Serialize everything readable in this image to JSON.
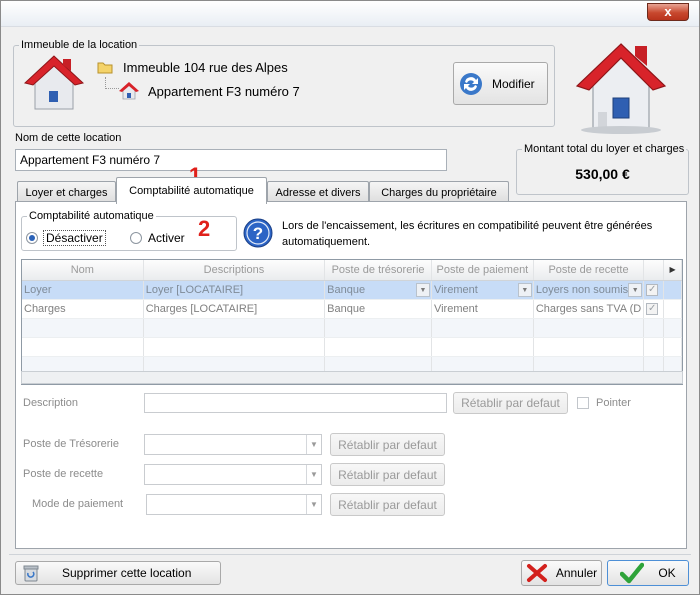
{
  "window": {
    "close_label": "x"
  },
  "building": {
    "legend": "Immeuble de la location",
    "tree_building": "Immeuble 104 rue des Alpes",
    "tree_apartment": "Appartement F3 numéro 7",
    "modify_label": "Modifier"
  },
  "location_name": {
    "label": "Nom de cette location",
    "value": "Appartement F3 numéro 7"
  },
  "total": {
    "legend": "Montant total du loyer et charges",
    "value": "530,00 €"
  },
  "annotations": {
    "tab_marker": "1",
    "radio_marker": "2"
  },
  "tabs": [
    {
      "label": "Loyer et charges",
      "active": false
    },
    {
      "label": "Comptabilité automatique",
      "active": true
    },
    {
      "label": "Adresse et divers",
      "active": false
    },
    {
      "label": "Charges du propriétaire",
      "active": false
    }
  ],
  "auto_accounting": {
    "legend": "Comptabilité automatique",
    "disable_label": "Désactiver",
    "enable_label": "Activer",
    "selected": "Désactiver",
    "info_text": "Lors de l'encaissement, les écritures en compatibilité peuvent être générées automatiquement."
  },
  "grid": {
    "columns": [
      "Nom",
      "Descriptions",
      "Poste de trésorerie",
      "Poste de paiement",
      "Poste de recette"
    ],
    "rows": [
      {
        "nom": "Loyer",
        "description": "Loyer [LOCATAIRE]",
        "tresorerie": "Banque",
        "paiement": "Virement",
        "recette": "Loyers non soumis",
        "checked": true
      },
      {
        "nom": "Charges",
        "description": "Charges [LOCATAIRE]",
        "tresorerie": "Banque",
        "paiement": "Virement",
        "recette": "Charges sans TVA (D",
        "checked": true
      }
    ]
  },
  "form": {
    "description_label": "Description",
    "description_value": "",
    "reset_label": "Rétablir par defaut",
    "pointer_label": "Pointer",
    "tresorerie_label": "Poste de Trésorerie",
    "recette_label": "Poste de recette",
    "paiement_label": "Mode de paiement"
  },
  "footer": {
    "delete_label": "Supprimer cette location",
    "cancel_label": "Annuler",
    "ok_label": "OK"
  },
  "colors": {
    "accent_red": "#e0201a",
    "selection": "#c7dcf7"
  }
}
